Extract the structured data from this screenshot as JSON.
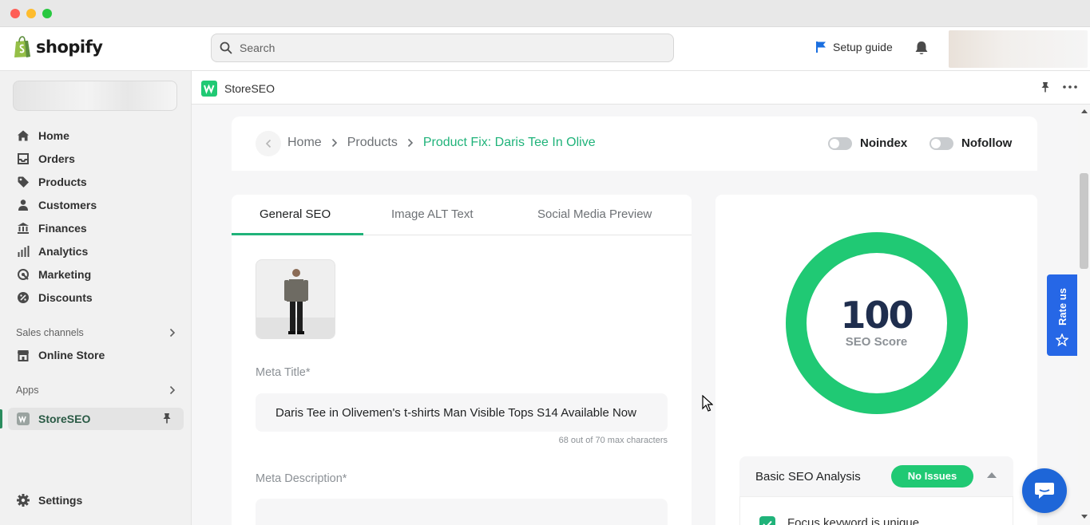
{
  "topbar": {
    "brand": "shopify",
    "search_placeholder": "Search",
    "setup_guide": "Setup guide"
  },
  "sidebar": {
    "items": [
      {
        "label": "Home",
        "icon": "home-icon"
      },
      {
        "label": "Orders",
        "icon": "orders-icon"
      },
      {
        "label": "Products",
        "icon": "products-tag-icon"
      },
      {
        "label": "Customers",
        "icon": "customers-icon"
      },
      {
        "label": "Finances",
        "icon": "finances-bank-icon"
      },
      {
        "label": "Analytics",
        "icon": "analytics-bars-icon"
      },
      {
        "label": "Marketing",
        "icon": "marketing-icon"
      },
      {
        "label": "Discounts",
        "icon": "discounts-icon"
      }
    ],
    "sales_channels_label": "Sales channels",
    "online_store_label": "Online Store",
    "apps_label": "Apps",
    "storeseo_label": "StoreSEO",
    "settings_label": "Settings"
  },
  "app": {
    "title": "StoreSEO"
  },
  "breadcrumb": {
    "home": "Home",
    "products": "Products",
    "current": "Product Fix: Daris Tee In Olive"
  },
  "toggles": {
    "noindex": "Noindex",
    "nofollow": "Nofollow"
  },
  "tabs": [
    "General SEO",
    "Image ALT Text",
    "Social Media Preview"
  ],
  "form": {
    "meta_title_label": "Meta Title*",
    "meta_title_value": "Daris Tee in Olivemen's t-shirts Man Visible Tops S14 Available Now",
    "meta_title_count": "68 out of 70 max characters",
    "meta_description_label": "Meta Description*"
  },
  "score": {
    "value": "100",
    "label": "SEO Score",
    "fraction": 1.0,
    "ring_color": "#20c974"
  },
  "analysis": {
    "title": "Basic SEO Analysis",
    "badge": "No Issues",
    "first_check": "Focus keyword is unique"
  },
  "rate_us": "Rate us",
  "colors": {
    "accent_green": "#20b37a",
    "rate_blue": "#2667e6",
    "chat_blue": "#1e66d8"
  }
}
